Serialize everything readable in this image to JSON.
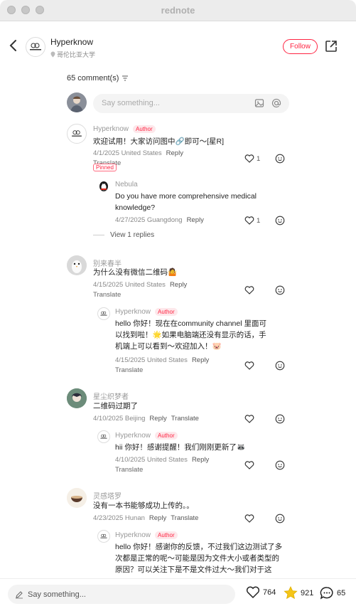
{
  "app_title": "rednote",
  "header": {
    "name": "Hyperknow",
    "location": "哥伦比亚大学",
    "follow_label": "Follow"
  },
  "comments_header": {
    "count": "65 comment(s)"
  },
  "input": {
    "placeholder": "Say something..."
  },
  "comments": [
    {
      "name": "Hyperknow",
      "badge": "Author",
      "pinned": "Pinned",
      "text": "欢迎试用！大家访问图中🔗即可～[星R]",
      "meta": "4/1/2025 United States",
      "reply": "Reply",
      "translate": "Translate",
      "likes": "1",
      "replies": [
        {
          "name": "Nebula",
          "text": "Do you have more comprehensive medical knowledge?",
          "meta": "4/27/2025 Guangdong",
          "reply": "Reply",
          "likes": "1"
        }
      ],
      "view_replies": "View 1 replies"
    },
    {
      "name": "别来春半",
      "text": "为什么没有微信二维码🤷",
      "meta": "4/15/2025 United States",
      "reply": "Reply",
      "translate": "Translate",
      "replies": [
        {
          "name": "Hyperknow",
          "badge": "Author",
          "text": "hello 你好！现在在community channel 里面可以找到啦！🌟如果电脑端还没有显示的话，手机端上可以看到～欢迎加入！🐷",
          "meta": "4/15/2025 United States",
          "reply": "Reply",
          "translate": "Translate"
        }
      ]
    },
    {
      "name": "星尘织梦者",
      "text": "二维码过期了",
      "meta": "4/10/2025 Beijing",
      "reply": "Reply",
      "translate": "Translate",
      "replies": [
        {
          "name": "Hyperknow",
          "badge": "Author",
          "text": "hii 你好！感谢提醒！我们刚刚更新了🦝",
          "meta": "4/10/2025 United States",
          "reply": "Reply",
          "translate": "Translate"
        }
      ]
    },
    {
      "name": "灵感塔罗",
      "text": "没有一本书能够成功上传的。。",
      "meta": "4/23/2025 Hunan",
      "reply": "Reply",
      "translate": "Translate",
      "replies": [
        {
          "name": "Hyperknow",
          "badge": "Author",
          "text": "hello 你好！感谢你的反馈，不过我们这边测试了多次都是正常的呢～可能是因为文件大小或者类型的原因？可以关注下是不是文件过大～我们对于这"
        }
      ]
    }
  ],
  "bottom": {
    "placeholder": "Say something...",
    "likes": "764",
    "collects": "921",
    "comments": "65"
  },
  "colors": {
    "accent": "#ff2442",
    "star": "#f5c518"
  }
}
